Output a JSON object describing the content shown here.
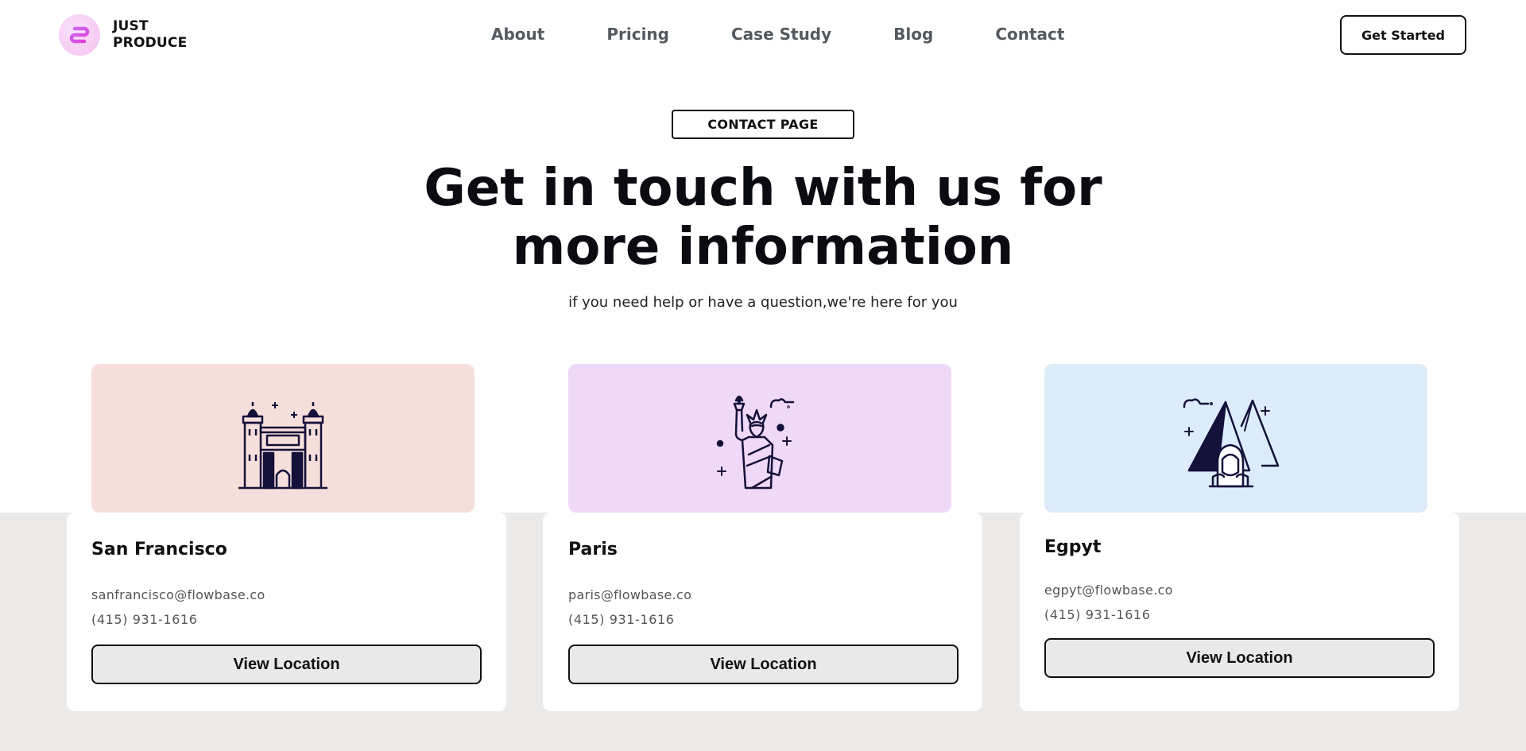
{
  "header": {
    "logo_line1": "JUST",
    "logo_line2": "PRODUCE",
    "nav": [
      "About",
      "Pricing",
      "Case Study",
      "Blog",
      "Contact"
    ],
    "cta": "Get Started"
  },
  "hero": {
    "badge": "CONTACT PAGE",
    "title_line1": "Get in touch with us for",
    "title_line2": "more information",
    "subtitle": "if you need help or have a question,we're here for you"
  },
  "locations": [
    {
      "name": "San Francisco",
      "email": "sanfrancisco@flowbase.co",
      "phone": "(415) 931-1616",
      "button": "View Location",
      "bg": "#f6dfdb",
      "icon": "castle-gate-icon"
    },
    {
      "name": "Paris",
      "email": "paris@flowbase.co",
      "phone": "(415) 931-1616",
      "button": "View Location",
      "bg": "#f0d9f8",
      "icon": "statue-of-liberty-icon"
    },
    {
      "name": "Egpyt",
      "email": "egpyt@flowbase.co",
      "phone": "(415) 931-1616",
      "button": "View Location",
      "bg": "#dcecfb",
      "icon": "pyramids-sphinx-icon"
    }
  ],
  "colors": {
    "ink": "#14113a",
    "band": "#ebeae9"
  }
}
